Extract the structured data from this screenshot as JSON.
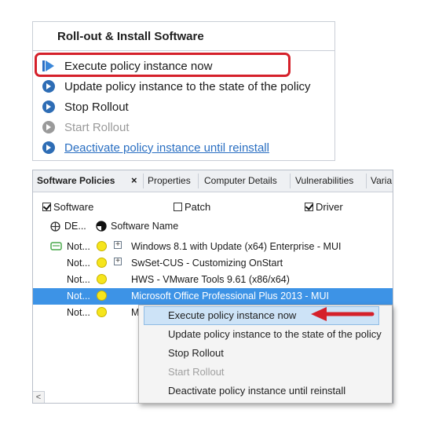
{
  "top_panel": {
    "title": "Roll-out & Install Software",
    "actions": [
      {
        "label": "Execute policy instance now",
        "icon": "execute-play-icon",
        "state": "highlighted"
      },
      {
        "label": "Update policy instance to the state of the policy",
        "icon": "arrow-circle-icon",
        "state": "enabled"
      },
      {
        "label": "Stop Rollout",
        "icon": "arrow-circle-icon",
        "state": "enabled"
      },
      {
        "label": "Start Rollout",
        "icon": "arrow-circle-icon",
        "state": "disabled"
      },
      {
        "label": "Deactivate policy instance until reinstall",
        "icon": "arrow-circle-icon",
        "state": "link"
      }
    ]
  },
  "tabs": [
    {
      "label": "Software Policies",
      "active": true,
      "close": "×"
    },
    {
      "label": "Properties"
    },
    {
      "label": "Computer Details"
    },
    {
      "label": "Vulnerabilities"
    },
    {
      "label": "Varia"
    }
  ],
  "filters": [
    {
      "label": "Software",
      "checked": true
    },
    {
      "label": "Patch",
      "checked": false
    },
    {
      "label": "Driver",
      "checked": true
    }
  ],
  "columns": {
    "status": "DE...",
    "name": "Software Name"
  },
  "rows": [
    {
      "status": "Not...",
      "name": "Windows 8.1 with Update (x64) Enterprise - MUI",
      "expand": "+",
      "tree_icon": true
    },
    {
      "status": "Not...",
      "name": "SwSet-CUS - Customizing OnStart",
      "expand": "+"
    },
    {
      "status": "Not...",
      "name": "HWS - VMware Tools 9.61 (x86/x64)"
    },
    {
      "status": "Not...",
      "name": "Microsoft Office Professional Plus 2013 - MUI",
      "selected": true
    },
    {
      "status": "Not...",
      "name": "M"
    }
  ],
  "context_menu": {
    "items": [
      {
        "label": "Execute policy instance now",
        "state": "hover"
      },
      {
        "label": "Update policy instance to the state of the policy",
        "state": "enabled"
      },
      {
        "label": "Stop Rollout",
        "state": "enabled"
      },
      {
        "label": "Start Rollout",
        "state": "disabled"
      },
      {
        "label": "Deactivate policy instance until reinstall",
        "state": "enabled"
      }
    ]
  },
  "scroll_left": "<",
  "colors": {
    "highlight_red": "#d5202a",
    "selection_blue": "#3d93e6",
    "link_blue": "#2a6fc2",
    "bulb_yellow": "#f6e51c"
  }
}
